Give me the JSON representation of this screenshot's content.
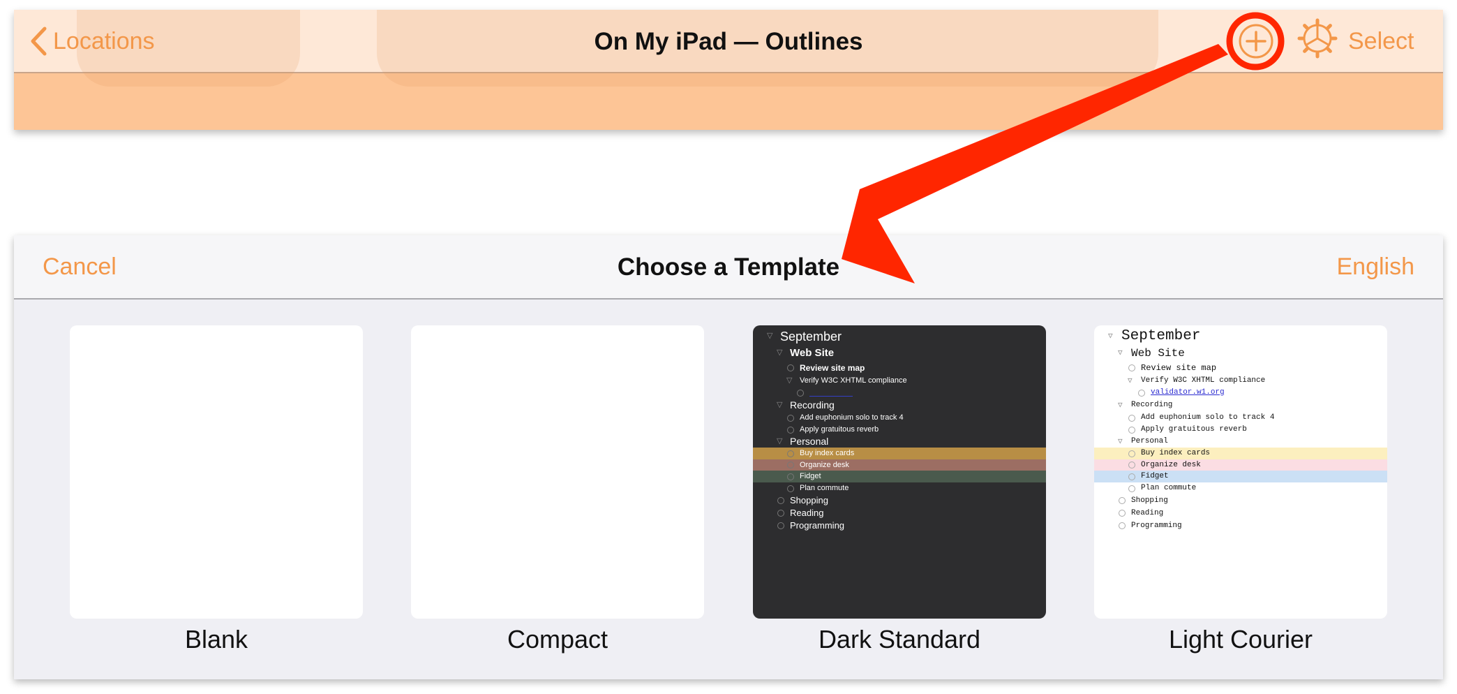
{
  "nav": {
    "back_label": "Locations",
    "title": "On My iPad — Outlines",
    "select_label": "Select",
    "accent": "#f39749"
  },
  "template_sheet": {
    "cancel_label": "Cancel",
    "title": "Choose a Template",
    "language_label": "English"
  },
  "templates": [
    {
      "label": "Blank"
    },
    {
      "label": "Compact"
    },
    {
      "label": "Dark Standard"
    },
    {
      "label": "Light Courier"
    }
  ],
  "preview_outline": {
    "dark": [
      {
        "text": "September",
        "level": 0,
        "marker": "triangle",
        "size": 18,
        "bold": false
      },
      {
        "text": "Web Site",
        "level": 1,
        "marker": "triangle",
        "size": 15,
        "bold": true
      },
      {
        "text": "Review site map",
        "level": 2,
        "marker": "circle",
        "size": 12,
        "bold": true
      },
      {
        "text": "Verify W3C XHTML compliance",
        "level": 2,
        "marker": "triangle",
        "size": 11,
        "bold": false
      },
      {
        "text": "",
        "level": 3,
        "marker": "circle",
        "size": 11,
        "bold": false,
        "link": true
      },
      {
        "text": "Recording",
        "level": 1,
        "marker": "triangle",
        "size": 14,
        "bold": false
      },
      {
        "text": "Add euphonium solo to track 4",
        "level": 2,
        "marker": "circle",
        "size": 11,
        "bold": false
      },
      {
        "text": "Apply gratuitous reverb",
        "level": 2,
        "marker": "circle",
        "size": 11,
        "bold": false
      },
      {
        "text": "Personal",
        "level": 1,
        "marker": "triangle",
        "size": 14,
        "bold": false
      },
      {
        "text": "Buy index cards",
        "level": 2,
        "marker": "circle",
        "size": 11,
        "bold": false,
        "highlight": "#b88e45"
      },
      {
        "text": "Organize desk",
        "level": 2,
        "marker": "circle",
        "size": 11,
        "bold": false,
        "highlight": "#9c6e63"
      },
      {
        "text": "Fidget",
        "level": 2,
        "marker": "circle",
        "size": 11,
        "bold": false,
        "highlight": "#4a5a4d"
      },
      {
        "text": "Plan commute",
        "level": 2,
        "marker": "circle",
        "size": 11,
        "bold": false
      },
      {
        "text": "Shopping",
        "level": 1,
        "marker": "circle",
        "size": 13,
        "bold": false
      },
      {
        "text": "Reading",
        "level": 1,
        "marker": "circle",
        "size": 13,
        "bold": false
      },
      {
        "text": "Programming",
        "level": 1,
        "marker": "circle",
        "size": 13,
        "bold": false
      }
    ],
    "light": [
      {
        "text": "September",
        "level": 0,
        "marker": "triangle",
        "size": 21,
        "bold": false
      },
      {
        "text": "Web Site",
        "level": 1,
        "marker": "triangle",
        "size": 16,
        "bold": false
      },
      {
        "text": "Review site map",
        "level": 2,
        "marker": "circle",
        "size": 12,
        "bold": false
      },
      {
        "text": "Verify W3C XHTML compliance",
        "level": 2,
        "marker": "triangle",
        "size": 11,
        "bold": false
      },
      {
        "text": "validator.w1.org",
        "level": 3,
        "marker": "circle",
        "size": 11,
        "bold": false,
        "link": true
      },
      {
        "text": "Recording",
        "level": 1,
        "marker": "triangle",
        "size": 11,
        "bold": false
      },
      {
        "text": "Add euphonium solo to track 4",
        "level": 2,
        "marker": "circle",
        "size": 11,
        "bold": false
      },
      {
        "text": "Apply gratuitous reverb",
        "level": 2,
        "marker": "circle",
        "size": 11,
        "bold": false
      },
      {
        "text": "Personal",
        "level": 1,
        "marker": "triangle",
        "size": 11,
        "bold": false
      },
      {
        "text": "Buy index cards",
        "level": 2,
        "marker": "circle",
        "size": 11,
        "bold": false,
        "highlight": "#fcefbf"
      },
      {
        "text": "Organize desk",
        "level": 2,
        "marker": "circle",
        "size": 11,
        "bold": false,
        "highlight": "#fbdde3"
      },
      {
        "text": "Fidget",
        "level": 2,
        "marker": "circle",
        "size": 11,
        "bold": false,
        "highlight": "#cbe0f5"
      },
      {
        "text": "Plan commute",
        "level": 2,
        "marker": "circle",
        "size": 11,
        "bold": false
      },
      {
        "text": "Shopping",
        "level": 1,
        "marker": "circle",
        "size": 11,
        "bold": false
      },
      {
        "text": "Reading",
        "level": 1,
        "marker": "circle",
        "size": 11,
        "bold": false
      },
      {
        "text": "Programming",
        "level": 1,
        "marker": "circle",
        "size": 11,
        "bold": false
      }
    ]
  },
  "annotation": {
    "color": "#ff2600"
  }
}
